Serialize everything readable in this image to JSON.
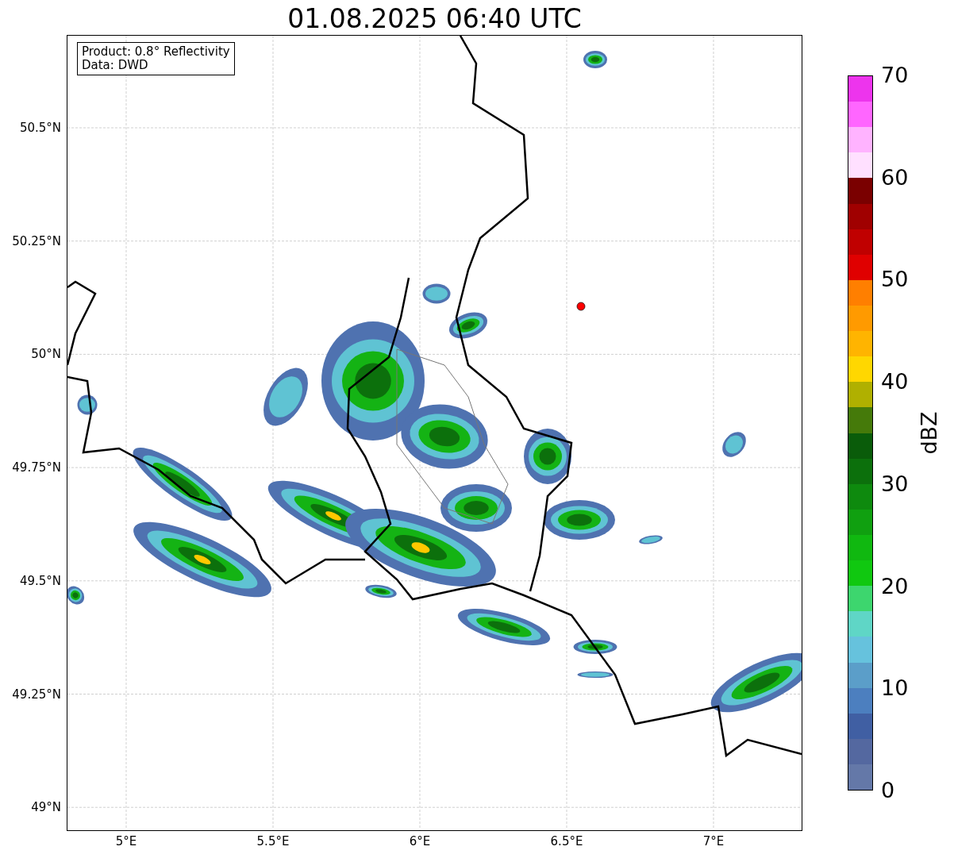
{
  "title": "01.08.2025 06:40 UTC",
  "info_box": [
    "Product: 0.8° Reflectivity",
    "Data: DWD"
  ],
  "lat_ticks": [
    "50.5°N",
    "50.25°N",
    "50°N",
    "49.75°N",
    "49.5°N",
    "49.25°N",
    "49°N"
  ],
  "lon_ticks": [
    "5°E",
    "5.5°E",
    "6°E",
    "6.5°E",
    "7°E"
  ],
  "colorbar": {
    "label": "dBZ",
    "ticks": [
      "70",
      "60",
      "50",
      "40",
      "30",
      "20",
      "10",
      "0"
    ],
    "levels": [
      {
        "color": "#ed34ed"
      },
      {
        "color": "#ff66ff"
      },
      {
        "color": "#ffb3ff"
      },
      {
        "color": "#ffe0ff"
      },
      {
        "color": "#7a0000"
      },
      {
        "color": "#a00000"
      },
      {
        "color": "#c00000"
      },
      {
        "color": "#e00000"
      },
      {
        "color": "#ff7f00"
      },
      {
        "color": "#ff9a00"
      },
      {
        "color": "#ffb400"
      },
      {
        "color": "#ffd700"
      },
      {
        "color": "#b0b000"
      },
      {
        "color": "#457a0a"
      },
      {
        "color": "#0a5c0a"
      },
      {
        "color": "#0c700c"
      },
      {
        "color": "#0e8a0e"
      },
      {
        "color": "#10a010"
      },
      {
        "color": "#10b810"
      },
      {
        "color": "#10c810"
      },
      {
        "color": "#3dd66e"
      },
      {
        "color": "#5fd6c6"
      },
      {
        "color": "#66c2dd"
      },
      {
        "color": "#5b9ec9"
      },
      {
        "color": "#4c7fbf"
      },
      {
        "color": "#405fa3"
      },
      {
        "color": "#5468a0"
      },
      {
        "color": "#6478a8"
      }
    ]
  }
}
